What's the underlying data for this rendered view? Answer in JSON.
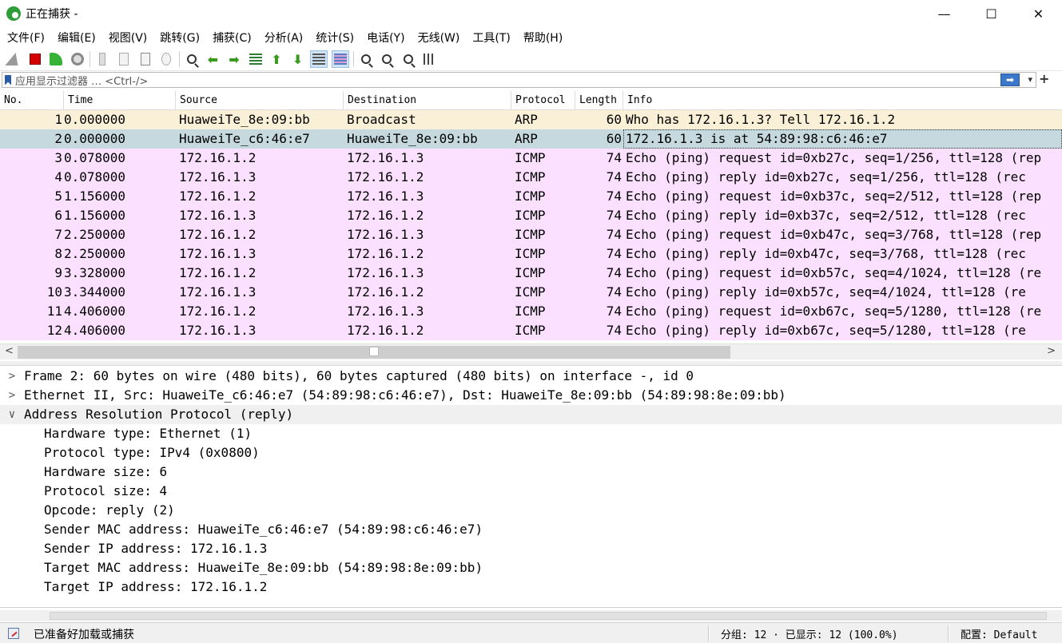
{
  "window": {
    "title": "正在捕获 -",
    "controls": {
      "minimize": "—",
      "maximize": "☐",
      "close": "✕"
    }
  },
  "menu": [
    "文件(F)",
    "编辑(E)",
    "视图(V)",
    "跳转(G)",
    "捕获(C)",
    "分析(A)",
    "统计(S)",
    "电话(Y)",
    "无线(W)",
    "工具(T)",
    "帮助(H)"
  ],
  "toolbar": {
    "icons": [
      "start-capture-icon",
      "stop-capture-icon",
      "restart-capture-icon",
      "capture-options-icon",
      "open-file-icon",
      "save-file-icon",
      "close-file-icon",
      "reload-file-icon",
      "find-packet-icon",
      "go-back-icon",
      "go-forward-icon",
      "go-to-packet-icon",
      "go-first-icon",
      "go-last-icon",
      "autoscroll-icon",
      "colorize-icon",
      "zoom-in-icon",
      "zoom-out-icon",
      "zoom-normal-icon",
      "resize-columns-icon"
    ]
  },
  "filter": {
    "placeholder": "应用显示过滤器 … <Ctrl-/>",
    "apply_glyph": "➡",
    "dropdown_glyph": "▾",
    "plus_glyph": "+"
  },
  "columns": [
    "No.",
    "Time",
    "Source",
    "Destination",
    "Protocol",
    "Length",
    "Info"
  ],
  "packets": [
    {
      "no": "1",
      "time": "0.000000",
      "src": "HuaweiTe_8e:09:bb",
      "dst": "Broadcast",
      "proto": "ARP",
      "len": "60",
      "info": "Who has 172.16.1.3? Tell 172.16.1.2",
      "color": "#faf0d7"
    },
    {
      "no": "2",
      "time": "0.000000",
      "src": "HuaweiTe_c6:46:e7",
      "dst": "HuaweiTe_8e:09:bb",
      "proto": "ARP",
      "len": "60",
      "info": "172.16.1.3 is at 54:89:98:c6:46:e7",
      "color": "#c5d9de"
    },
    {
      "no": "3",
      "time": "0.078000",
      "src": "172.16.1.2",
      "dst": "172.16.1.3",
      "proto": "ICMP",
      "len": "74",
      "info": "Echo (ping) request  id=0xb27c, seq=1/256, ttl=128 (rep",
      "color": "#fce0ff"
    },
    {
      "no": "4",
      "time": "0.078000",
      "src": "172.16.1.3",
      "dst": "172.16.1.2",
      "proto": "ICMP",
      "len": "74",
      "info": "Echo (ping) reply    id=0xb27c, seq=1/256, ttl=128 (rec",
      "color": "#fce0ff"
    },
    {
      "no": "5",
      "time": "1.156000",
      "src": "172.16.1.2",
      "dst": "172.16.1.3",
      "proto": "ICMP",
      "len": "74",
      "info": "Echo (ping) request  id=0xb37c, seq=2/512, ttl=128 (rep",
      "color": "#fce0ff"
    },
    {
      "no": "6",
      "time": "1.156000",
      "src": "172.16.1.3",
      "dst": "172.16.1.2",
      "proto": "ICMP",
      "len": "74",
      "info": "Echo (ping) reply    id=0xb37c, seq=2/512, ttl=128 (rec",
      "color": "#fce0ff"
    },
    {
      "no": "7",
      "time": "2.250000",
      "src": "172.16.1.2",
      "dst": "172.16.1.3",
      "proto": "ICMP",
      "len": "74",
      "info": "Echo (ping) request  id=0xb47c, seq=3/768, ttl=128 (rep",
      "color": "#fce0ff"
    },
    {
      "no": "8",
      "time": "2.250000",
      "src": "172.16.1.3",
      "dst": "172.16.1.2",
      "proto": "ICMP",
      "len": "74",
      "info": "Echo (ping) reply    id=0xb47c, seq=3/768, ttl=128 (rec",
      "color": "#fce0ff"
    },
    {
      "no": "9",
      "time": "3.328000",
      "src": "172.16.1.2",
      "dst": "172.16.1.3",
      "proto": "ICMP",
      "len": "74",
      "info": "Echo (ping) request  id=0xb57c, seq=4/1024, ttl=128 (re",
      "color": "#fce0ff"
    },
    {
      "no": "10",
      "time": "3.344000",
      "src": "172.16.1.3",
      "dst": "172.16.1.2",
      "proto": "ICMP",
      "len": "74",
      "info": "Echo (ping) reply    id=0xb57c, seq=4/1024, ttl=128 (re",
      "color": "#fce0ff"
    },
    {
      "no": "11",
      "time": "4.406000",
      "src": "172.16.1.2",
      "dst": "172.16.1.3",
      "proto": "ICMP",
      "len": "74",
      "info": "Echo (ping) request  id=0xb67c, seq=5/1280, ttl=128 (re",
      "color": "#fce0ff"
    },
    {
      "no": "12",
      "time": "4.406000",
      "src": "172.16.1.3",
      "dst": "172.16.1.2",
      "proto": "ICMP",
      "len": "74",
      "info": "Echo (ping) reply    id=0xb67c, seq=5/1280, ttl=128 (re",
      "color": "#fce0ff"
    }
  ],
  "selected_packet": "2",
  "details": {
    "frame": "Frame 2: 60 bytes on wire (480 bits), 60 bytes captured (480 bits) on interface -, id 0",
    "ethernet": "Ethernet II, Src: HuaweiTe_c6:46:e7 (54:89:98:c6:46:e7), Dst: HuaweiTe_8e:09:bb (54:89:98:8e:09:bb)",
    "arp": "Address Resolution Protocol (reply)",
    "arp_fields": [
      "Hardware type: Ethernet (1)",
      "Protocol type: IPv4 (0x0800)",
      "Hardware size: 6",
      "Protocol size: 4",
      "Opcode: reply (2)",
      "Sender MAC address: HuaweiTe_c6:46:e7 (54:89:98:c6:46:e7)",
      "Sender IP address: 172.16.1.3",
      "Target MAC address: HuaweiTe_8e:09:bb (54:89:98:8e:09:bb)",
      "Target IP address: 172.16.1.2"
    ],
    "collapsed_glyph": ">",
    "expanded_glyph": "∨"
  },
  "status": {
    "ready": "已准备好加载或捕获",
    "packets": "分组: 12 · 已显示: 12 (100.0%)",
    "profile": "配置: Default"
  },
  "scroll": {
    "left": "<",
    "right": ">"
  }
}
